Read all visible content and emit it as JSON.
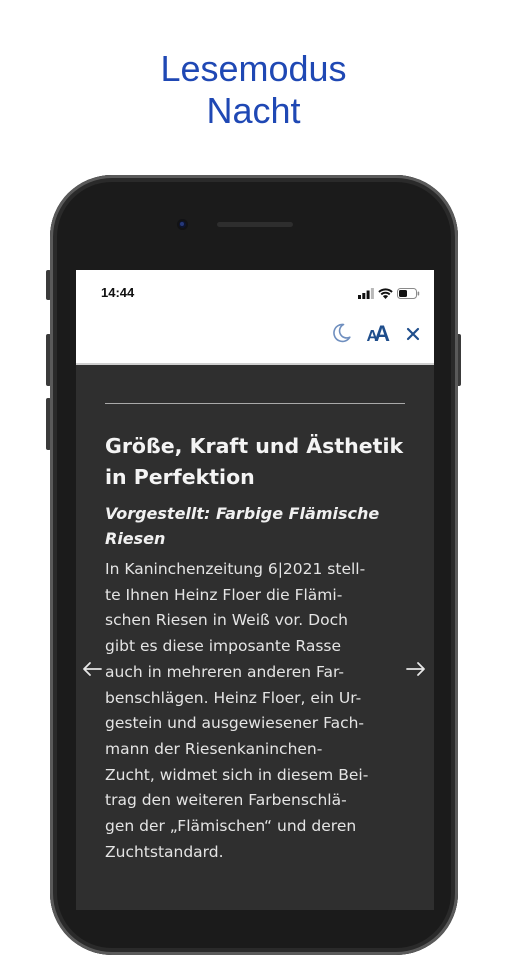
{
  "promo": {
    "title_line1": "Lesemodus",
    "title_line2": "Nacht",
    "color": "#1f48b4"
  },
  "status_bar": {
    "time": "14:44",
    "icons": [
      "signal-icon",
      "wifi-icon",
      "battery-icon"
    ]
  },
  "toolbar": {
    "night_mode_icon": "moon-icon",
    "font_size_label_big": "A",
    "font_size_label_small": "A",
    "close_icon": "close-icon",
    "accent": "#1f4e8c"
  },
  "article": {
    "headline": "Größe, Kraft und Ästhetik in Perfektion",
    "subline": "Vorgestellt: Farbige Flämische Riesen",
    "body": "In Kaninchenzeitung 6|2021 stell-\nte Ihnen Heinz Floer die Flämi-\nschen Riesen in Weiß vor. Doch\ngibt es diese imposante Rasse\nauch in mehreren anderen Far-\nbenschlägen. Heinz Floer, ein Ur-\ngestein und ausgewiesener Fach-\nmann der Riesenkaninchen-\nZucht, widmet sich in diesem Bei-\ntrag den weiteren Farbenschlä-\ngen der „Flämischen“ und deren\nZuchtstandard."
  },
  "navigation": {
    "prev_icon": "arrow-left-icon",
    "next_icon": "arrow-right-icon"
  },
  "theme": {
    "screen_background": "#2f2f2f",
    "text_color": "#e4e4e4"
  }
}
